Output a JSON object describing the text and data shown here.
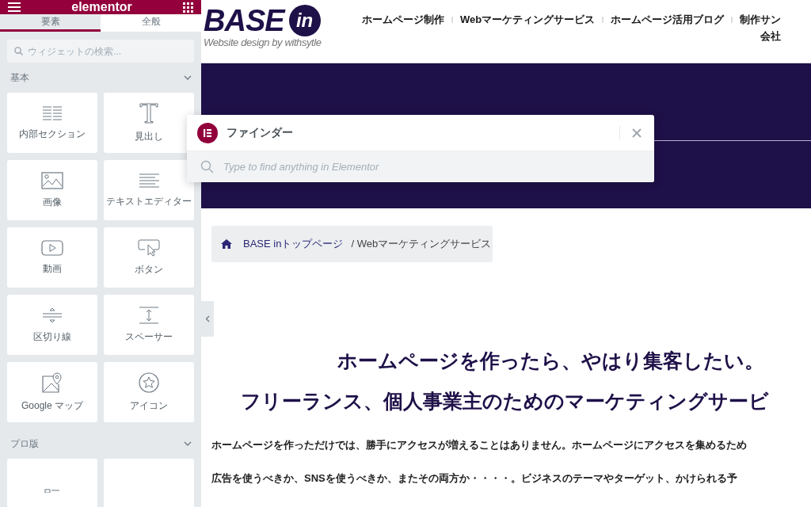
{
  "panel": {
    "logo": "elementor",
    "tabs": [
      {
        "label": "要素",
        "selected": true
      },
      {
        "label": "全般",
        "selected": false
      }
    ],
    "search": {
      "placeholder": "ウィジェットの検索..."
    },
    "categories": [
      {
        "title": "基本",
        "expanded": true,
        "widgets": [
          {
            "kind": "inner-section",
            "label": "内部セクション"
          },
          {
            "kind": "heading",
            "label": "見出し"
          },
          {
            "kind": "image",
            "label": "画像"
          },
          {
            "kind": "text-editor",
            "label": "テキストエディター"
          },
          {
            "kind": "video",
            "label": "動画"
          },
          {
            "kind": "button",
            "label": "ボタン"
          },
          {
            "kind": "divider",
            "label": "区切り線"
          },
          {
            "kind": "spacer",
            "label": "スペーサー"
          },
          {
            "kind": "map",
            "label": "Google マップ"
          },
          {
            "kind": "icon",
            "label": "アイコン"
          }
        ]
      },
      {
        "title": "プロ版",
        "expanded": true,
        "widgets": [
          {
            "kind": "posts"
          },
          {
            "kind": "blank"
          }
        ]
      }
    ]
  },
  "site": {
    "logo": {
      "brand": "BASE",
      "badge": "in",
      "tagline": "Website design by withsytle"
    },
    "nav": [
      "ホームページ制作",
      "Webマーケティングサービス",
      "ホームページ活用ブログ",
      "制作サン"
    ],
    "nav_second_line": "会社",
    "breadcrumb": {
      "home": "BASE inトップページ",
      "current": "/ Webマーケティングサービス"
    },
    "headings": [
      "ホームページを作ったら、やはり集客したい。",
      "フリーランス、個人事業主のためのマーケティングサービ"
    ],
    "paragraphs": [
      "ホームページを作っただけでは、勝手にアクセスが増えることはありません。ホームページにアクセスを集めるため",
      "広告を使うべきか、SNSを使うべきか、またその両方か・・・・。ビジネスのテーマやターゲット、かけられる予"
    ]
  },
  "finder": {
    "title": "ファインダー",
    "placeholder": "Type to find anything in Elementor"
  }
}
